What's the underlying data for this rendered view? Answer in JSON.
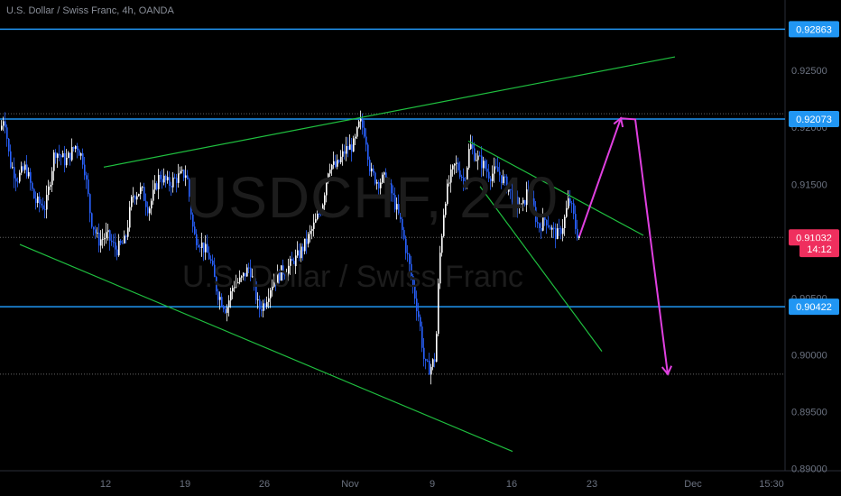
{
  "header": {
    "symbol_line": "U.S. Dollar / Swiss Franc, 4h, OANDA"
  },
  "watermark": {
    "ticker": "USDCHF, 240",
    "name": "U.S. Dollar / Swiss Franc"
  },
  "price_axis": {
    "ticks": [
      "0.92500",
      "0.92000",
      "0.91500",
      "0.91000",
      "0.90500",
      "0.90000",
      "0.89500",
      "0.89000"
    ],
    "tick_values": [
      0.925,
      0.92,
      0.915,
      0.91,
      0.905,
      0.9,
      0.895,
      0.89
    ],
    "range": [
      0.8898,
      0.9312
    ]
  },
  "time_axis": {
    "labels": [
      "12",
      "19",
      "26",
      "Nov",
      "9",
      "16",
      "23",
      "Dec",
      "15:30"
    ]
  },
  "price_labels": [
    {
      "text": "0.92863",
      "value": 0.92863,
      "color": "#2196f3"
    },
    {
      "text": "0.92073",
      "value": 0.92073,
      "color": "#2196f3"
    },
    {
      "text": "0.91032",
      "value": 0.91032,
      "color": "#ef2f5e"
    },
    {
      "text": "14:12",
      "value": 0.9093,
      "color": "#ef2f5e"
    },
    {
      "text": "0.90422",
      "value": 0.90422,
      "color": "#2196f3"
    }
  ],
  "colors": {
    "horizontal_level": "#2196f3",
    "trendline": "#1fbf3f",
    "projection": "#e040e0",
    "candle_up": "#ffffff",
    "candle_down": "#2962ff",
    "dotted_level": "#666666"
  },
  "chart_data": {
    "type": "candlestick",
    "title": "U.S. Dollar / Swiss Franc, 4h, OANDA",
    "ylim": [
      0.8898,
      0.9312
    ],
    "horizontal_levels": [
      0.92863,
      0.92073,
      0.90422
    ],
    "dotted_levels": [
      0.9212,
      0.91032,
      0.8983
    ],
    "last_price": 0.91032,
    "close_path": [
      [
        0,
        0.9198
      ],
      [
        4,
        0.9212
      ],
      [
        10,
        0.917
      ],
      [
        18,
        0.9155
      ],
      [
        28,
        0.9165
      ],
      [
        38,
        0.9135
      ],
      [
        50,
        0.913
      ],
      [
        60,
        0.918
      ],
      [
        72,
        0.917
      ],
      [
        84,
        0.9185
      ],
      [
        92,
        0.917
      ],
      [
        100,
        0.912
      ],
      [
        108,
        0.91
      ],
      [
        118,
        0.9105
      ],
      [
        128,
        0.9092
      ],
      [
        138,
        0.91
      ],
      [
        146,
        0.914
      ],
      [
        156,
        0.9145
      ],
      [
        164,
        0.9128
      ],
      [
        176,
        0.9158
      ],
      [
        186,
        0.915
      ],
      [
        196,
        0.9156
      ],
      [
        206,
        0.916
      ],
      [
        214,
        0.9105
      ],
      [
        222,
        0.9098
      ],
      [
        232,
        0.9085
      ],
      [
        240,
        0.9055
      ],
      [
        250,
        0.904
      ],
      [
        258,
        0.9062
      ],
      [
        266,
        0.9065
      ],
      [
        276,
        0.9078
      ],
      [
        286,
        0.904
      ],
      [
        292,
        0.9045
      ],
      [
        300,
        0.9062
      ],
      [
        310,
        0.9072
      ],
      [
        320,
        0.9078
      ],
      [
        328,
        0.9085
      ],
      [
        338,
        0.9098
      ],
      [
        348,
        0.9115
      ],
      [
        356,
        0.913
      ],
      [
        364,
        0.9168
      ],
      [
        372,
        0.9165
      ],
      [
        382,
        0.918
      ],
      [
        392,
        0.9185
      ],
      [
        398,
        0.9205
      ],
      [
        404,
        0.9195
      ],
      [
        410,
        0.916
      ],
      [
        418,
        0.9152
      ],
      [
        426,
        0.9155
      ],
      [
        434,
        0.914
      ],
      [
        442,
        0.912
      ],
      [
        450,
        0.909
      ],
      [
        456,
        0.9065
      ],
      [
        464,
        0.903
      ],
      [
        470,
        0.899
      ],
      [
        476,
        0.8988
      ],
      [
        482,
        0.8998
      ],
      [
        486,
        0.908
      ],
      [
        492,
        0.9135
      ],
      [
        498,
        0.9155
      ],
      [
        504,
        0.9168
      ],
      [
        510,
        0.916
      ],
      [
        514,
        0.915
      ],
      [
        520,
        0.9185
      ],
      [
        526,
        0.9175
      ],
      [
        534,
        0.9168
      ],
      [
        542,
        0.9158
      ],
      [
        550,
        0.9162
      ],
      [
        560,
        0.915
      ],
      [
        570,
        0.9135
      ],
      [
        578,
        0.9128
      ],
      [
        584,
        0.9145
      ],
      [
        590,
        0.913
      ],
      [
        596,
        0.9112
      ],
      [
        604,
        0.912
      ],
      [
        612,
        0.9108
      ],
      [
        618,
        0.9105
      ],
      [
        624,
        0.9116
      ],
      [
        630,
        0.9138
      ],
      [
        634,
        0.9125
      ],
      [
        638,
        0.9108
      ],
      [
        642,
        0.9104
      ]
    ],
    "trendlines": [
      {
        "name": "channel-upper",
        "from": [
          115,
          0.9165
        ],
        "to": [
          748,
          0.9262
        ]
      },
      {
        "name": "channel-lower",
        "from": [
          22,
          0.9097
        ],
        "to": [
          568,
          0.8915
        ]
      },
      {
        "name": "wedge-upper",
        "from": [
          519,
          0.9188
        ],
        "to": [
          713,
          0.9105
        ]
      },
      {
        "name": "wedge-lower",
        "from": [
          532,
          0.9148
        ],
        "to": [
          667,
          0.9003
        ]
      }
    ],
    "projection": {
      "points": [
        [
          642,
          0.9104
        ],
        [
          688,
          0.9208
        ],
        [
          704,
          0.9207
        ],
        [
          740,
          0.8983
        ]
      ]
    }
  }
}
